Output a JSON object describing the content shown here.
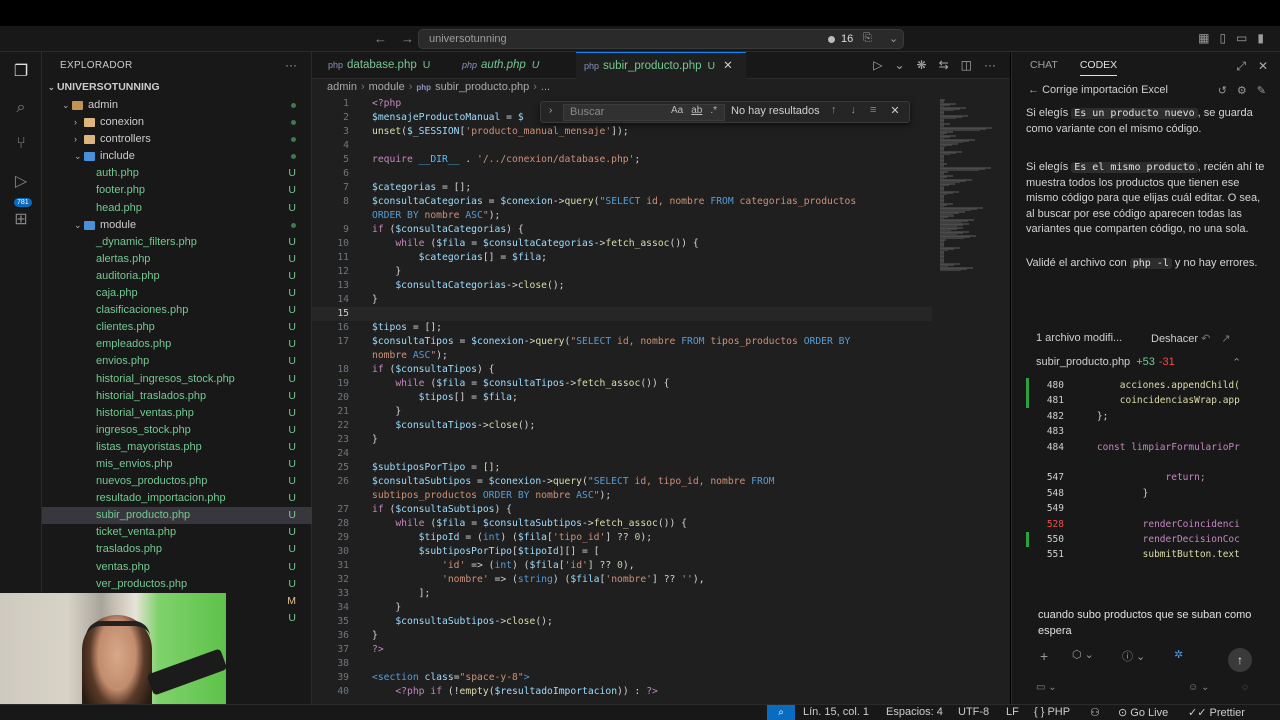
{
  "titlebar": {
    "search_text": "universotunning",
    "notification_count": "16"
  },
  "activity": {
    "scm_badge": "781"
  },
  "sidebar": {
    "heading": "EXPLORADOR",
    "root": "UNIVERSOTUNNING",
    "items": [
      {
        "label": "admin",
        "type": "folder-open",
        "depth": 1,
        "status": "dot"
      },
      {
        "label": "conexion",
        "type": "folder",
        "depth": 2,
        "status": "dot"
      },
      {
        "label": "controllers",
        "type": "folder",
        "depth": 2,
        "status": "dot"
      },
      {
        "label": "include",
        "type": "folder-open",
        "depth": 2,
        "status": "dot"
      },
      {
        "label": "auth.php",
        "type": "file",
        "depth": 3,
        "status": "U"
      },
      {
        "label": "footer.php",
        "type": "file",
        "depth": 3,
        "status": "U"
      },
      {
        "label": "head.php",
        "type": "file",
        "depth": 3,
        "status": "U"
      },
      {
        "label": "module",
        "type": "folder-open",
        "depth": 2,
        "status": "dot"
      },
      {
        "label": "_dynamic_filters.php",
        "type": "file",
        "depth": 3,
        "status": "U"
      },
      {
        "label": "alertas.php",
        "type": "file",
        "depth": 3,
        "status": "U"
      },
      {
        "label": "auditoria.php",
        "type": "file",
        "depth": 3,
        "status": "U"
      },
      {
        "label": "caja.php",
        "type": "file",
        "depth": 3,
        "status": "U"
      },
      {
        "label": "clasificaciones.php",
        "type": "file",
        "depth": 3,
        "status": "U"
      },
      {
        "label": "clientes.php",
        "type": "file",
        "depth": 3,
        "status": "U"
      },
      {
        "label": "empleados.php",
        "type": "file",
        "depth": 3,
        "status": "U"
      },
      {
        "label": "envios.php",
        "type": "file",
        "depth": 3,
        "status": "U"
      },
      {
        "label": "historial_ingresos_stock.php",
        "type": "file",
        "depth": 3,
        "status": "U"
      },
      {
        "label": "historial_traslados.php",
        "type": "file",
        "depth": 3,
        "status": "U"
      },
      {
        "label": "historial_ventas.php",
        "type": "file",
        "depth": 3,
        "status": "U"
      },
      {
        "label": "ingresos_stock.php",
        "type": "file",
        "depth": 3,
        "status": "U"
      },
      {
        "label": "listas_mayoristas.php",
        "type": "file",
        "depth": 3,
        "status": "U"
      },
      {
        "label": "mis_envios.php",
        "type": "file",
        "depth": 3,
        "status": "U"
      },
      {
        "label": "nuevos_productos.php",
        "type": "file",
        "depth": 3,
        "status": "U"
      },
      {
        "label": "resultado_importacion.php",
        "type": "file",
        "depth": 3,
        "status": "U"
      },
      {
        "label": "subir_producto.php",
        "type": "file",
        "depth": 3,
        "status": "U",
        "selected": true
      },
      {
        "label": "ticket_venta.php",
        "type": "file",
        "depth": 3,
        "status": "U"
      },
      {
        "label": "traslados.php",
        "type": "file",
        "depth": 3,
        "status": "U"
      },
      {
        "label": "ventas.php",
        "type": "file",
        "depth": 3,
        "status": "U"
      },
      {
        "label": "ver_productos.php",
        "type": "file",
        "depth": 3,
        "status": "U"
      }
    ],
    "extra_statuses": [
      "M",
      "U"
    ]
  },
  "editor": {
    "tabs": [
      {
        "label": "database.php",
        "status": "U"
      },
      {
        "label": "auth.php",
        "status": "U"
      },
      {
        "label": "subir_producto.php",
        "status": "U",
        "active": true
      }
    ],
    "breadcrumb": [
      "admin",
      "module",
      "subir_producto.php",
      "..."
    ],
    "find": {
      "placeholder": "Buscar",
      "result": "No hay resultados"
    },
    "lines": [
      {
        "n": "1",
        "html": "<span class='kw'>&lt;?php</span>"
      },
      {
        "n": "2",
        "html": "<span class='var'>$mensajeProductoManual</span> = <span class='var'>$</span>"
      },
      {
        "n": "3",
        "html": "<span class='fn'>unset</span>(<span class='var'>$_SESSION</span>[<span class='str'>'producto_manual_mensaje'</span>]);"
      },
      {
        "n": "4",
        "html": ""
      },
      {
        "n": "5",
        "html": "<span class='kw'>require</span> <span class='const'>__DIR__</span> . <span class='str'>'/../conexion/database.php'</span>;"
      },
      {
        "n": "6",
        "html": ""
      },
      {
        "n": "7",
        "html": "<span class='var'>$categorias</span> = [];"
      },
      {
        "n": "8",
        "html": "<span class='var'>$consultaCategorias</span> = <span class='var'>$conexion</span>-&gt;<span class='fn'>query</span>(<span class='str'>\"</span><span class='sql'>SELECT</span><span class='str'> id, nombre </span><span class='sql'>FROM</span><span class='str'> categorias_productos</span>"
      },
      {
        "n": "",
        "html": "<span class='sql'>ORDER BY</span><span class='str'> nombre </span><span class='sql'>ASC</span><span class='str'>\"</span>);"
      },
      {
        "n": "9",
        "html": "<span class='kw'>if</span> (<span class='var'>$consultaCategorias</span>) {"
      },
      {
        "n": "10",
        "html": "    <span class='kw'>while</span> (<span class='var'>$fila</span> = <span class='var'>$consultaCategorias</span>-&gt;<span class='fn'>fetch_assoc</span>()) {"
      },
      {
        "n": "11",
        "html": "        <span class='var'>$categorias</span>[] = <span class='var'>$fila</span>;"
      },
      {
        "n": "12",
        "html": "    }"
      },
      {
        "n": "13",
        "html": "    <span class='var'>$consultaCategorias</span>-&gt;<span class='fn'>close</span>();"
      },
      {
        "n": "14",
        "html": "}"
      },
      {
        "n": "15",
        "html": "",
        "current": true
      },
      {
        "n": "16",
        "html": "<span class='var'>$tipos</span> = [];"
      },
      {
        "n": "17",
        "html": "<span class='var'>$consultaTipos</span> = <span class='var'>$conexion</span>-&gt;<span class='fn'>query</span>(<span class='str'>\"</span><span class='sql'>SELECT</span><span class='str'> id, nombre </span><span class='sql'>FROM</span><span class='str'> tipos_productos </span><span class='sql'>ORDER BY</span>"
      },
      {
        "n": "",
        "html": "<span class='str'>nombre </span><span class='sql'>ASC</span><span class='str'>\"</span>);"
      },
      {
        "n": "18",
        "html": "<span class='kw'>if</span> (<span class='var'>$consultaTipos</span>) {"
      },
      {
        "n": "19",
        "html": "    <span class='kw'>while</span> (<span class='var'>$fila</span> = <span class='var'>$consultaTipos</span>-&gt;<span class='fn'>fetch_assoc</span>()) {"
      },
      {
        "n": "20",
        "html": "        <span class='var'>$tipos</span>[] = <span class='var'>$fila</span>;"
      },
      {
        "n": "21",
        "html": "    }"
      },
      {
        "n": "22",
        "html": "    <span class='var'>$consultaTipos</span>-&gt;<span class='fn'>close</span>();"
      },
      {
        "n": "23",
        "html": "}"
      },
      {
        "n": "24",
        "html": ""
      },
      {
        "n": "25",
        "html": "<span class='var'>$subtiposPorTipo</span> = [];"
      },
      {
        "n": "26",
        "html": "<span class='var'>$consultaSubtipos</span> = <span class='var'>$conexion</span>-&gt;<span class='fn'>query</span>(<span class='str'>\"</span><span class='sql'>SELECT</span><span class='str'> id, tipo_id, nombre </span><span class='sql'>FROM</span>"
      },
      {
        "n": "",
        "html": "<span class='str'>subtipos_productos </span><span class='sql'>ORDER BY</span><span class='str'> nombre </span><span class='sql'>ASC</span><span class='str'>\"</span>);"
      },
      {
        "n": "27",
        "html": "<span class='kw'>if</span> (<span class='var'>$consultaSubtipos</span>) {"
      },
      {
        "n": "28",
        "html": "    <span class='kw'>while</span> (<span class='var'>$fila</span> = <span class='var'>$consultaSubtipos</span>-&gt;<span class='fn'>fetch_assoc</span>()) {"
      },
      {
        "n": "29",
        "html": "        <span class='var'>$tipoId</span> = (<span class='sql'>int</span>) (<span class='var'>$fila</span>[<span class='str'>'tipo_id'</span>] ?? <span class='num2'>0</span>);"
      },
      {
        "n": "30",
        "html": "        <span class='var'>$subtiposPorTipo</span>[<span class='var'>$tipoId</span>][] = ["
      },
      {
        "n": "31",
        "html": "            <span class='str'>'id'</span> =&gt; (<span class='sql'>int</span>) (<span class='var'>$fila</span>[<span class='str'>'id'</span>] ?? <span class='num2'>0</span>),"
      },
      {
        "n": "32",
        "html": "            <span class='str'>'nombre'</span> =&gt; (<span class='sql'>string</span>) (<span class='var'>$fila</span>[<span class='str'>'nombre'</span>] ?? <span class='str'>''</span>),"
      },
      {
        "n": "33",
        "html": "        ];"
      },
      {
        "n": "34",
        "html": "    }"
      },
      {
        "n": "35",
        "html": "    <span class='var'>$consultaSubtipos</span>-&gt;<span class='fn'>close</span>();"
      },
      {
        "n": "36",
        "html": "}"
      },
      {
        "n": "37",
        "html": "<span class='kw'>?&gt;</span>"
      },
      {
        "n": "38",
        "html": ""
      },
      {
        "n": "39",
        "html": "<span class='tag'>&lt;section</span> <span class='var'>class</span>=<span class='str'>\"space-y-8\"</span><span class='tag'>&gt;</span>"
      },
      {
        "n": "40",
        "html": "    <span class='kw'>&lt;?php</span> <span class='kw'>if</span> (!<span class='fn'>empty</span>(<span class='var'>$resultadoImportacion</span>)) : <span class='kw'>?&gt;</span>"
      }
    ]
  },
  "chat": {
    "tabs": [
      "CHAT",
      "CODEX"
    ],
    "thread_title": "Corrige importación Excel",
    "messages": [
      {
        "parts": [
          "Si elegís ",
          {
            "chip": "Es un producto nuevo"
          },
          ", se guarda como variante con el mismo código."
        ]
      },
      {
        "parts": [
          "Si elegís ",
          {
            "chip": "Es el mismo producto"
          },
          ", recién ahí te muestra todos los productos que tienen ese mismo código para que elijas cuál editar. O sea, al buscar por ese código aparecen todas las variantes que comparten código, no una sola."
        ]
      },
      {
        "parts": [
          "Validé el archivo con ",
          {
            "chip": "php -l"
          },
          " y no hay errores."
        ]
      }
    ],
    "diff": {
      "summary": "1 archivo modifi...",
      "undo": "Deshacer",
      "file": "subir_producto.php",
      "additions": "+53",
      "deletions": "-31",
      "lines": [
        {
          "n": "480",
          "text": "        acciones.appendChild(",
          "color": "fn",
          "bar": true
        },
        {
          "n": "481",
          "text": "        coincidenciasWrap.app",
          "color": "fn",
          "bar": true
        },
        {
          "n": "482",
          "text": "    };",
          "color": "plain"
        },
        {
          "n": "483",
          "text": "",
          "color": "plain"
        },
        {
          "n": "484",
          "text": "    const limpiarFormularioPr",
          "color": "kw"
        },
        {
          "n": "",
          "text": "",
          "color": "plain"
        },
        {
          "n": "547",
          "text": "                return;",
          "color": "kw"
        },
        {
          "n": "548",
          "text": "            }",
          "color": "plain"
        },
        {
          "n": "549",
          "text": "",
          "color": "plain"
        },
        {
          "n": "528",
          "text": "            renderCoincidenci",
          "color": "kw",
          "numColor": "red"
        },
        {
          "n": "550",
          "text": "            renderDecisionCoc",
          "color": "kw",
          "bar": true
        },
        {
          "n": "551",
          "text": "            submitButton.text",
          "color": "fn"
        }
      ]
    },
    "input_text": "cuando subo productos que se suban como espera"
  },
  "statusbar": {
    "position": "Lín. 15, col. 1",
    "spaces": "Espacios: 4",
    "encoding": "UTF-8",
    "eol": "LF",
    "language": "PHP",
    "golive": "Go Live",
    "prettier": "Prettier"
  }
}
